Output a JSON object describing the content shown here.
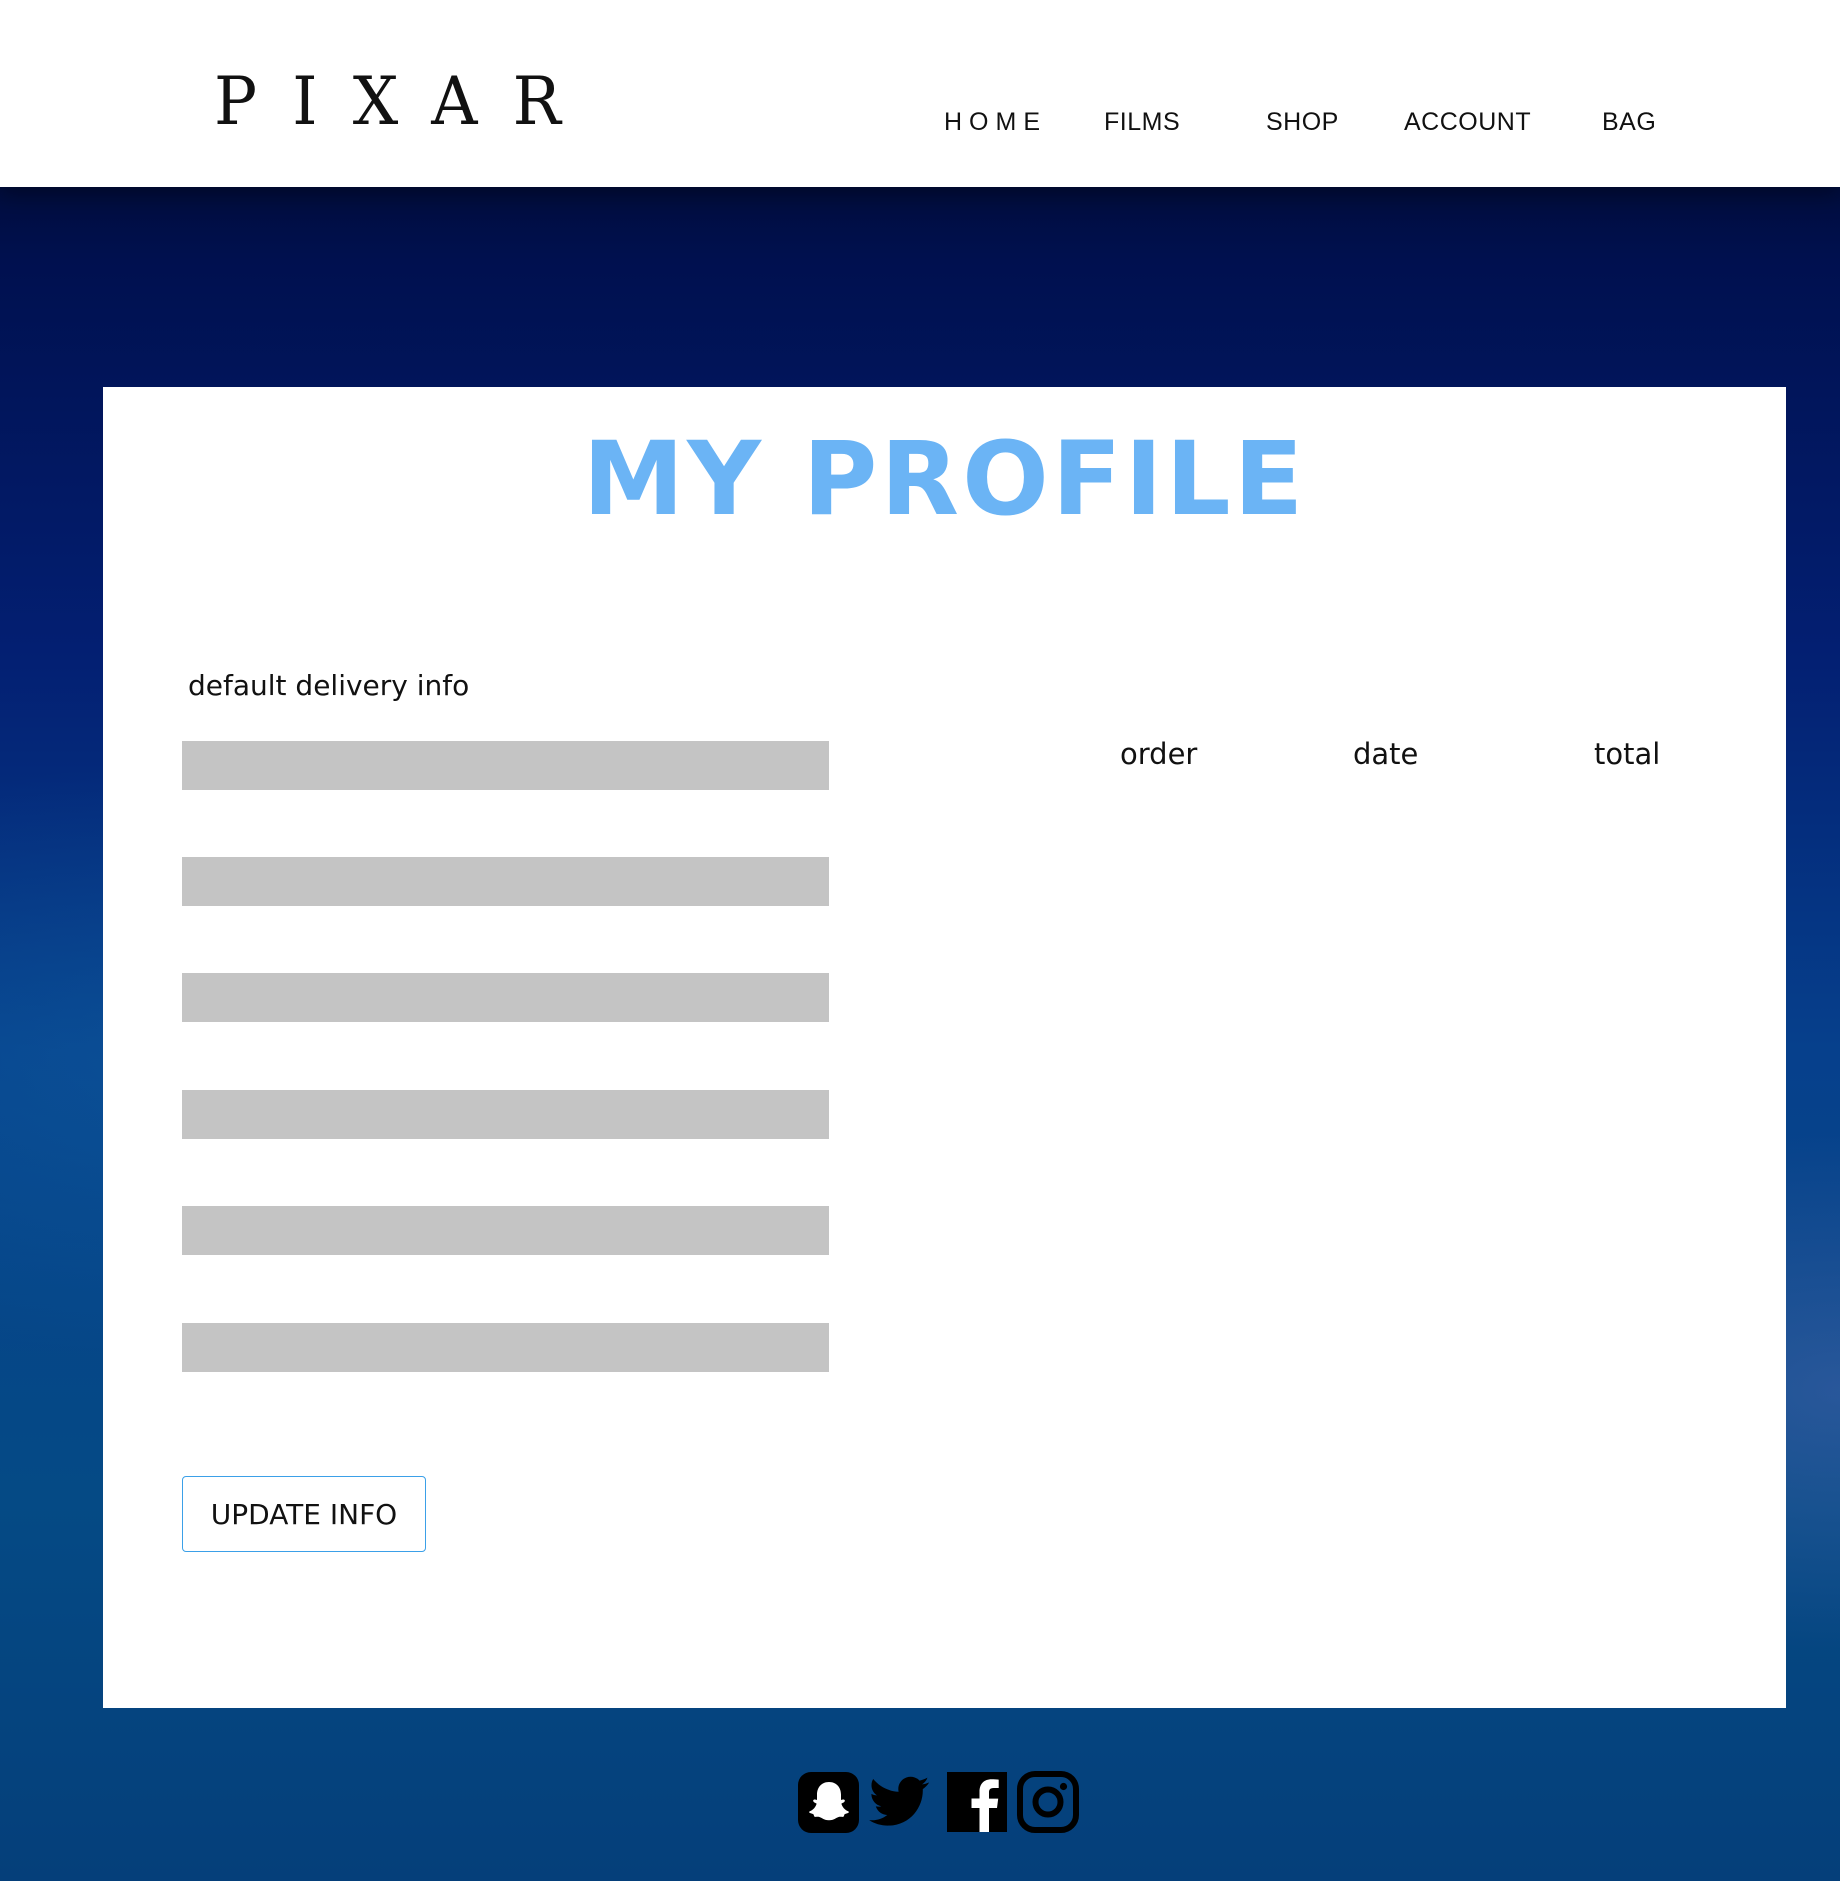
{
  "header": {
    "logo": "PIXAR",
    "nav": {
      "home": "HOME",
      "films": "FILMS",
      "shop": "SHOP",
      "account": "ACCOUNT",
      "bag": "BAG"
    }
  },
  "profile": {
    "title": "MY PROFILE",
    "delivery_label": "default delivery info",
    "fields": [
      "",
      "",
      "",
      "",
      "",
      ""
    ],
    "update_button": "UPDATE INFO",
    "orders": {
      "columns": [
        "order",
        "date",
        "total"
      ],
      "rows": []
    }
  },
  "footer": {
    "social_icons": [
      "snapchat-icon",
      "twitter-icon",
      "facebook-icon",
      "instagram-icon"
    ]
  },
  "colors": {
    "title_accent": "#6bb4f5",
    "field_fill": "#c4c4c4",
    "button_border": "#3ba0e8",
    "page_background": "#031f72"
  }
}
